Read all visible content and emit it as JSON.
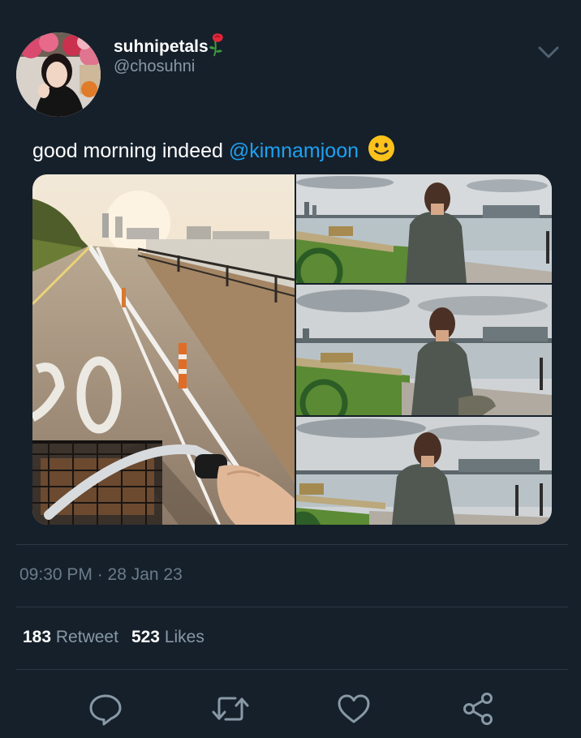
{
  "tweet": {
    "display_name": "suhnipetals",
    "display_name_emoji": "rose-emoji",
    "username": "@chosuhni",
    "text_prefix": "good morning indeed ",
    "mention": "@kimnamjoon",
    "text_emoji": "slightly-smiling-face-emoji",
    "timestamp": "09:30 PM · 28 Jan 23",
    "retweet_count": "183",
    "retweet_label": "Retweet",
    "likes_count": "523",
    "likes_label": "Likes"
  },
  "media": {
    "photo_count": 4,
    "photos": [
      "bicycle-path-by-river-photo",
      "man-seated-by-river-photo-1",
      "man-seated-by-river-photo-2",
      "man-seated-by-river-photo-3"
    ]
  },
  "actions": [
    "reply-icon",
    "retweet-icon",
    "like-icon",
    "share-icon"
  ],
  "colors": {
    "background": "#16202b",
    "mention": "#1da1f2",
    "secondary_text": "#8899a6",
    "divider": "#2b3744"
  }
}
